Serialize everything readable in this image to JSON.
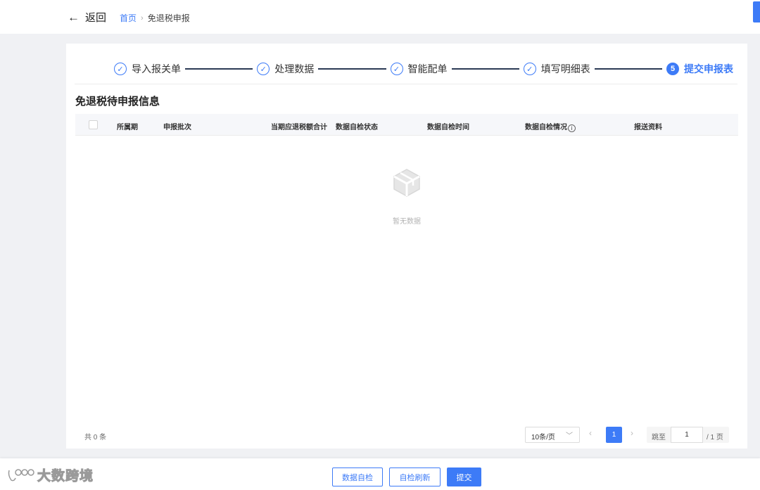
{
  "header": {
    "back_label": "返回",
    "breadcrumb": [
      "首页",
      "免退税申报"
    ]
  },
  "steps": [
    {
      "label": "导入报关单",
      "status": "done"
    },
    {
      "label": "处理数据",
      "status": "done"
    },
    {
      "label": "智能配单",
      "status": "done"
    },
    {
      "label": "填写明细表",
      "status": "done"
    },
    {
      "label": "提交申报表",
      "status": "active",
      "number": "5"
    }
  ],
  "section_title": "免退税待申报信息",
  "table": {
    "columns": [
      "所属期",
      "申报批次",
      "当期应退税额合计",
      "数据自检状态",
      "数据自检时间",
      "数据自检情况",
      "报送资料"
    ],
    "rows": [],
    "empty_text": "暂无数据"
  },
  "pagination": {
    "total_text": "共 0 条",
    "page_size": "10条/页",
    "current_page": "1",
    "jump_label": "跳至",
    "jump_value": "1",
    "total_pages": "/ 1 页"
  },
  "footer": {
    "buttons": [
      "数据自检",
      "自检刷新",
      "提交"
    ],
    "watermark": "大数跨境"
  },
  "colors": {
    "accent": "#3d7bf7",
    "background": "#f0f1f4"
  }
}
